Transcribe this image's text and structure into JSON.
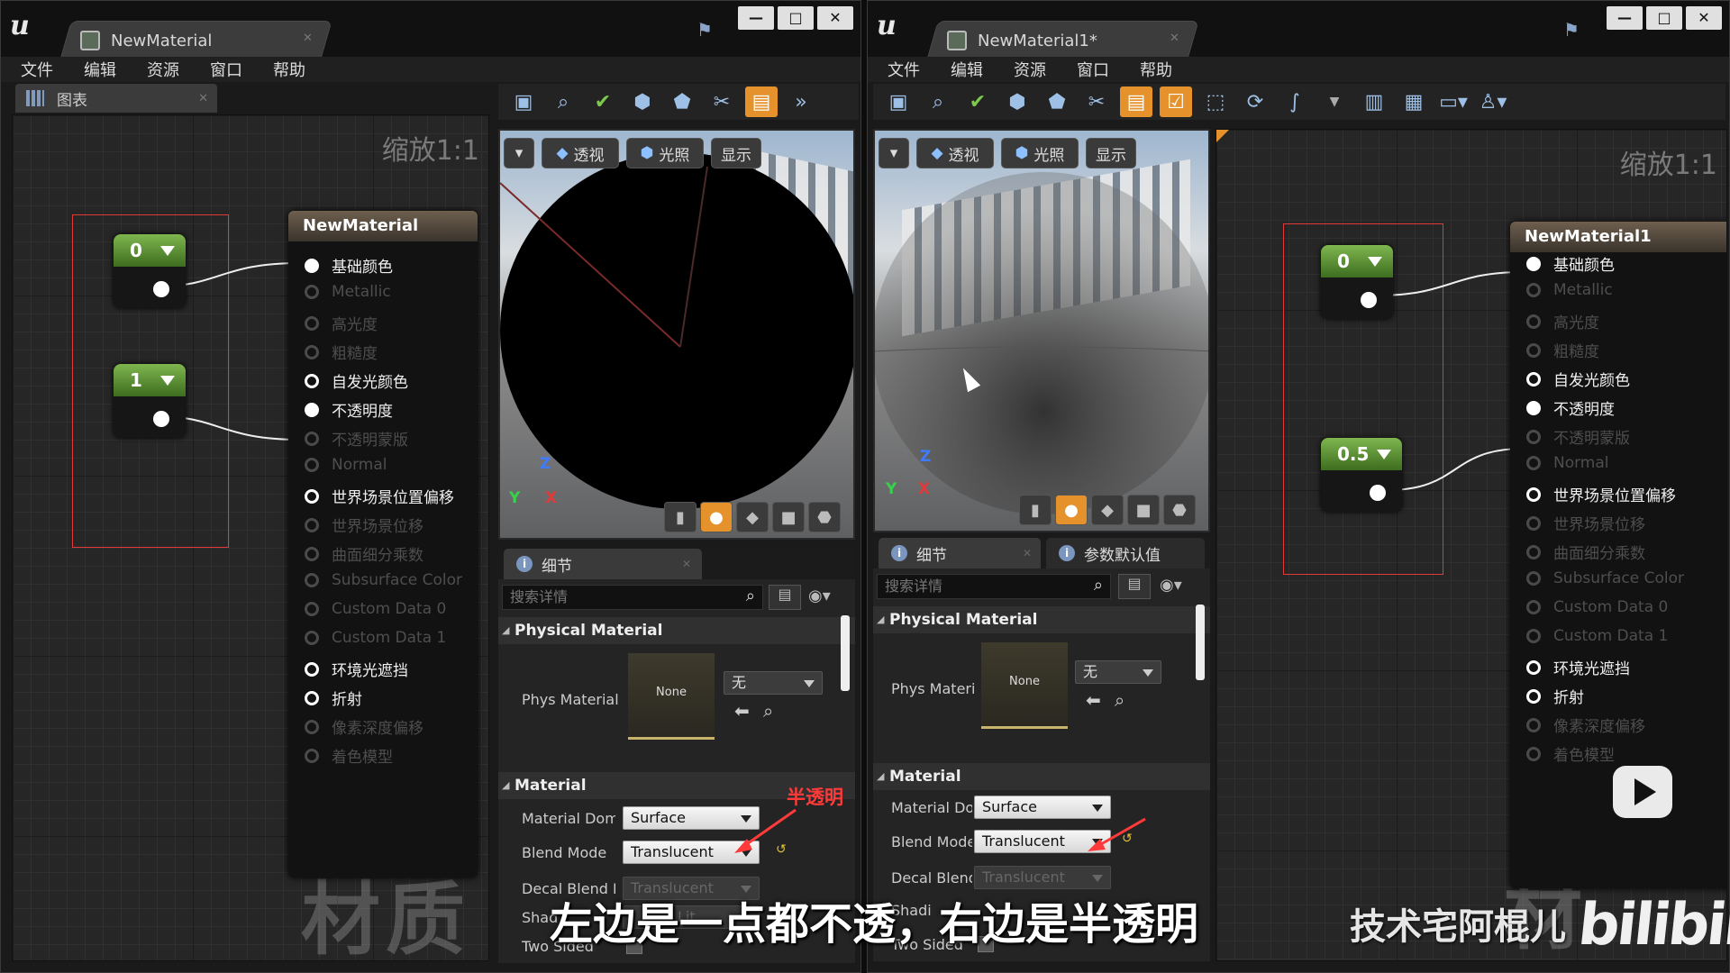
{
  "menu": [
    "文件",
    "编辑",
    "资源",
    "窗口",
    "帮助"
  ],
  "left": {
    "tab_title": "NewMaterial",
    "graph_tab": "图表",
    "zoom": "缩放1:1",
    "watermark": "材质",
    "const_a": "0",
    "const_b": "1",
    "node_title": "NewMaterial",
    "viewport_buttons": [
      "透视",
      "光照",
      "显示"
    ],
    "details_tab": "细节",
    "search_placeholder": "搜索详情",
    "cat_physical": "Physical Material",
    "phys_label": "Phys Material",
    "thumb_label": "None",
    "phys_combo": "无",
    "cat_material": "Material",
    "material_domain_label": "Material Dom",
    "material_domain": "Surface",
    "blend_mode_label": "Blend Mode",
    "blend_mode": "Translucent",
    "decal_label": "Decal Blend M",
    "decal_value": "Translucent",
    "shading_label": "Shad",
    "shading_value": "Lit",
    "two_sided_label": "Two Sided",
    "annotation": "半透明"
  },
  "right": {
    "tab_title": "NewMaterial1*",
    "zoom": "缩放1:1",
    "watermark": "材",
    "const_a": "0",
    "const_b": "0.5",
    "node_title": "NewMaterial1",
    "viewport_buttons": [
      "透视",
      "光照",
      "显示"
    ],
    "details_tab": "细节",
    "params_tab": "参数默认值",
    "search_placeholder": "搜索详情",
    "cat_physical": "Physical Material",
    "phys_label": "Phys Materi",
    "thumb_label": "None",
    "phys_combo": "无",
    "cat_material": "Material",
    "material_domain_label": "Material Dor",
    "material_domain": "Surface",
    "blend_mode_label": "Blend Mode",
    "blend_mode": "Translucent",
    "decal_label": "Decal Blend",
    "decal_value": "Translucent",
    "shading_label": "Shadi",
    "two_sided_label": "Two Sided"
  },
  "pins": [
    {
      "label": "基础颜色",
      "state": "connected"
    },
    {
      "label": "Metallic",
      "state": "disabled"
    },
    {
      "label": "高光度",
      "state": "disabled"
    },
    {
      "label": "粗糙度",
      "state": "disabled"
    },
    {
      "label": "自发光颜色",
      "state": "enabled"
    },
    {
      "label": "不透明度",
      "state": "connected"
    },
    {
      "label": "不透明蒙版",
      "state": "disabled"
    },
    {
      "label": "Normal",
      "state": "disabled"
    },
    {
      "label": "世界场景位置偏移",
      "state": "enabled"
    },
    {
      "label": "世界场景位移",
      "state": "disabled"
    },
    {
      "label": "曲面细分乘数",
      "state": "disabled"
    },
    {
      "label": "Subsurface Color",
      "state": "disabled"
    },
    {
      "label": "Custom Data 0",
      "state": "disabled"
    },
    {
      "label": "Custom Data 1",
      "state": "disabled"
    },
    {
      "label": "环境光遮挡",
      "state": "enabled"
    },
    {
      "label": "折射",
      "state": "enabled"
    },
    {
      "label": "像素深度偏移",
      "state": "disabled"
    },
    {
      "label": "着色模型",
      "state": "disabled"
    }
  ],
  "axes": {
    "z": "Z",
    "y": "Y",
    "x": "X"
  },
  "subtitle": "左边是一点都不透，右边是半透明",
  "brand": "技术宅阿棍儿",
  "bili_logo": "bilibili",
  "colors": {
    "accent": "#e5922d",
    "annotation": "#ff3a3a",
    "const_green": "#7fb64f"
  }
}
